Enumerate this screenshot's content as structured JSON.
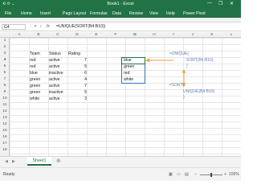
{
  "window": {
    "quick_access": "⟲ ⟳ ⌄",
    "title": "Book1 - Excel",
    "controls": [
      "—",
      "❐",
      "✕"
    ]
  },
  "ribbon_tabs": [
    "File",
    "Home",
    "Insert",
    "Page Layout",
    "Formulas",
    "Data",
    "Review",
    "View",
    "Help",
    "Power Pivot"
  ],
  "formula_bar": {
    "name_box": "G4",
    "fx": "fx",
    "formula": "=UNIQUE(SORT(B4:B10))"
  },
  "columns": [
    "A",
    "B",
    "C",
    "D",
    "E",
    "F",
    "G",
    "H",
    "I",
    "J",
    "K",
    "L"
  ],
  "rows": [
    "1",
    "2",
    "3",
    "4",
    "5",
    "6",
    "7",
    "8",
    "9",
    "10",
    "11",
    "12",
    "13",
    "14",
    "15",
    "16",
    "17",
    "18"
  ],
  "table": {
    "headers": [
      "Team",
      "Status",
      "Rating"
    ],
    "rows": [
      [
        "red",
        "active",
        "7"
      ],
      [
        "red",
        "active",
        "5"
      ],
      [
        "blue",
        "inactive",
        "6"
      ],
      [
        "green",
        "active",
        "4"
      ],
      [
        "green",
        "active",
        "7"
      ],
      [
        "green",
        "inactive",
        "5"
      ],
      [
        "white",
        "active",
        "3"
      ]
    ]
  },
  "spill": [
    "blue",
    "green",
    "red",
    "white"
  ],
  "annotations": {
    "a1": "=UNIQUE(",
    "a2": "SORT(B4:B10)",
    "a3": ")",
    "b1": "=SORT(",
    "b2": "UNIQUE(B4:B10)",
    "b3": ")"
  },
  "sheet_tab": "Sheet1",
  "status": {
    "ready": "Ready",
    "zoom": "100%"
  },
  "colors": {
    "excel_green": "#217346",
    "arrow_orange": "#f2a23a",
    "note_blue": "#5b7fb0"
  }
}
